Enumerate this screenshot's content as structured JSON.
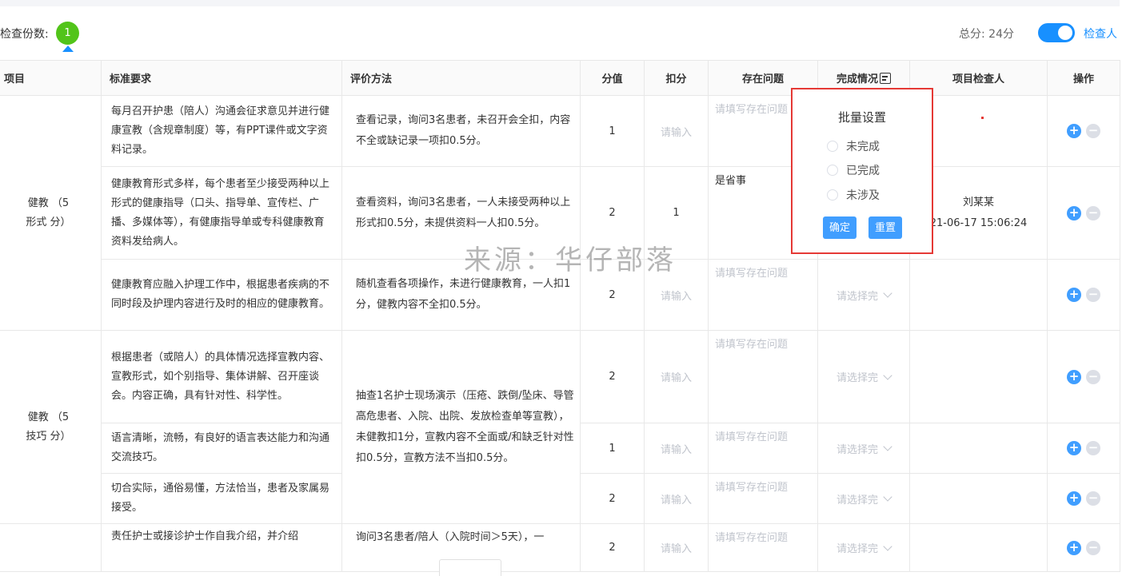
{
  "header": {
    "count_label": "检查份数:",
    "count_value": "1",
    "total_label": "总分: 24分",
    "toggle_label": "检查人"
  },
  "table": {
    "columns": [
      "项目",
      "标准要求",
      "评价方法",
      "分值",
      "扣分",
      "存在问题",
      "完成情况",
      "项目检查人",
      "操作"
    ],
    "placeholders": {
      "deduct": "请输入",
      "issue": "请填写存在问题",
      "status": "请选择完"
    },
    "groups": [
      {
        "item": "健教（5形式 分）",
        "item_line1": "健教 （5",
        "item_line2": "形式 分）",
        "rows": [
          {
            "standard": "每月召开护患（陪人）沟通会征求意见并进行健康宣教（含规章制度）等，有PPT课件或文字资料记录。",
            "method": "查看记录，询问3名患者，未召开会全扣，内容不全或缺记录一项扣0.5分。",
            "score": "1"
          },
          {
            "standard": "健康教育形式多样，每个患者至少接受两种以上形式的健康指导（口头、指导单、宣传栏、广播、多媒体等），有健康指导单或专科健康教育资料发给病人。",
            "method": "查看资料，询问3名患者，一人未接受两种以上形式扣0.5分，未提供资料一人扣0.5分。",
            "score": "2",
            "deduct": "1",
            "issue": "是省事",
            "inspector_name": "刘某某",
            "inspector_time": "21-06-17 15:06:24"
          },
          {
            "standard": "健康教育应融入护理工作中，根据患者疾病的不同时段及护理内容进行及时的相应的健康教育。",
            "method": "随机查看各项操作，未进行健康教育，一人扣1分，健教内容不全扣0.5分。",
            "score": "2"
          }
        ]
      },
      {
        "item_line1": "健教 （5",
        "item_line2": "技巧 分）",
        "method": "抽查1名护士现场演示（压疮、跌倒/坠床、导管高危患者、入院、出院、发放检查单等宣教），未健教扣1分，宣教内容不全面或/和缺乏针对性扣0.5分，宣教方法不当扣0.5分。",
        "rows": [
          {
            "standard": "根据患者（或陪人）的具体情况选择宣教内容、宣教形式，如个别指导、集体讲解、召开座谈会。内容正确，具有针对性、科学性。",
            "score": "2"
          },
          {
            "standard": "语言清晰，流畅，有良好的语言表达能力和沟通交流技巧。",
            "score": "1"
          },
          {
            "standard": "切合实际，通俗易懂，方法恰当，患者及家属易接受。",
            "score": "2"
          }
        ]
      },
      {
        "rows": [
          {
            "standard": "责任护士或接诊护士作自我介绍，并介绍",
            "method": "询问3名患者/陪人（入院时间＞5天），一",
            "score": "2"
          }
        ]
      }
    ]
  },
  "popover": {
    "title": "批量设置",
    "options": [
      "未完成",
      "已完成",
      "未涉及"
    ],
    "confirm_label": "确定",
    "reset_label": "重置"
  },
  "watermark": "来源：华仔部落",
  "colors": {
    "primary": "#409eff",
    "badge": "#52c41a",
    "highlight_border": "#e53935",
    "placeholder": "#c0c4cc"
  }
}
